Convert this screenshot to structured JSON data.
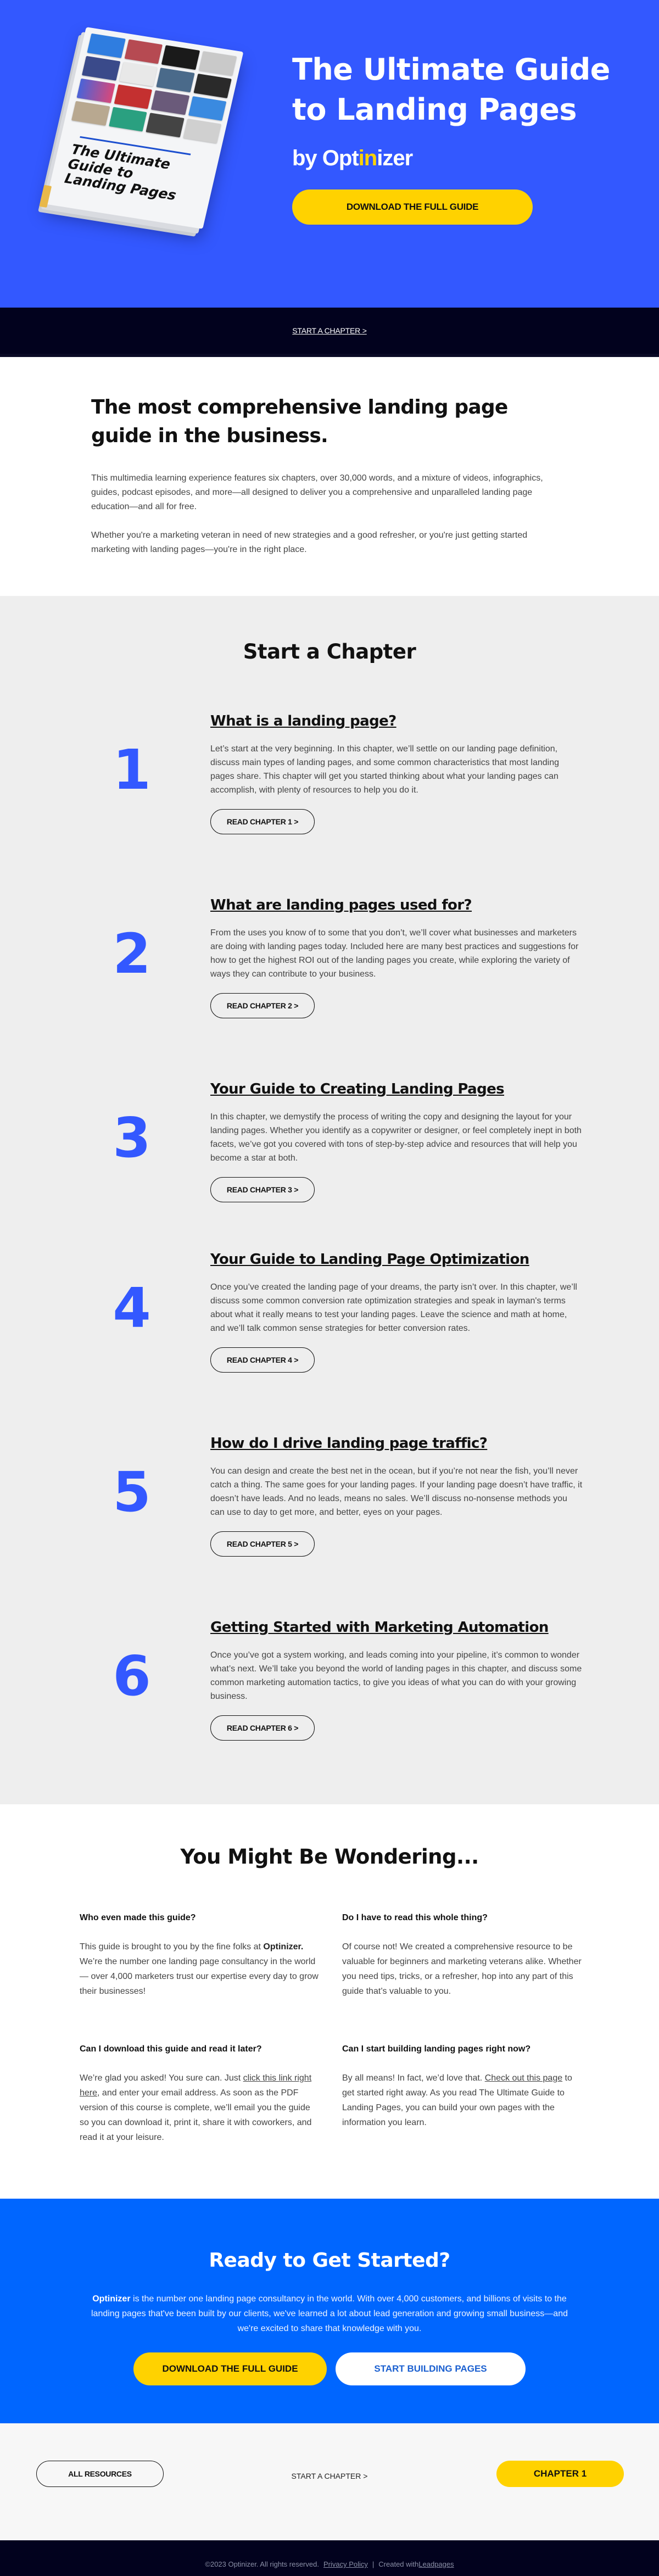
{
  "colors": {
    "hero_bg": "#3358ff",
    "accent_yellow": "#ffd200",
    "dark_nav": "#02021e",
    "chapters_bg": "#eeeeee",
    "cta_bg": "#0066ff",
    "chapter_number": "#3358ff"
  },
  "hero": {
    "book_cover_title": "The Ultimate Guide to Landing Pages",
    "title": "The Ultimate Guide to Landing Pages",
    "by_prefix": "by ",
    "brand_part1": "Opt",
    "brand_accent": "in",
    "brand_part2": "izer",
    "cta_label": "Download the full guide"
  },
  "top_nav": {
    "link_label": "START A CHAPTER >"
  },
  "intro": {
    "heading": "The most comprehensive landing page guide in the business.",
    "paragraphs": [
      "This multimedia learning experience features six chapters, over 30,000 words, and a mixture of videos, infographics, guides, podcast episodes, and more—all designed to deliver you a comprehensive and unparalleled landing page education—and all for free.",
      "Whether you're a marketing veteran in need of new strategies and a good refresher, or you're just getting started marketing with landing pages—you're in the right place."
    ]
  },
  "chapters": {
    "heading": "Start a Chapter",
    "items": [
      {
        "number": "1",
        "title": "What is a landing page?",
        "description": "Let’s start at the very beginning. In this chapter, we’ll settle on our landing page definition, discuss main types of landing pages, and some common characteristics that most landing pages share. This chapter will get you started thinking about what your landing pages can accomplish, with plenty of resources to help you do it.",
        "button": "Read chapter 1 >"
      },
      {
        "number": "2",
        "title": "What are landing pages used for?",
        "description": "From the uses you know of to some that you don’t, we’ll cover what businesses and marketers are doing with landing pages today. Included here are many best practices and suggestions for how to get the highest ROI out of the landing pages you create, while exploring the variety of ways they can contribute to your business.",
        "button": "Read chapter 2 >"
      },
      {
        "number": "3",
        "title": "Your Guide to Creating Landing Pages",
        "description": "In this chapter, we demystify the process of writing the copy and designing the layout for your landing pages. Whether you identify as a copywriter or designer, or feel completely inept in both facets, we’ve got you covered with tons of step-by-step advice and resources that will help you become a star at both.",
        "button": "Read chapter 3 >"
      },
      {
        "number": "4",
        "title": "Your Guide to Landing Page Optimization",
        "description": "Once you’ve created the landing page of your dreams, the party isn’t over. In this chapter, we’ll discuss some common conversion rate optimization strategies and speak in layman's terms about what it really means to test your landing pages. Leave the science and math at home, and we’ll talk common sense strategies for better conversion rates.",
        "button": "Read chapter 4 >"
      },
      {
        "number": "5",
        "title": "How do I drive landing page traffic?",
        "description": "You can design and create the best net in the ocean, but if you’re not near the fish, you’ll never catch a thing. The same goes for your landing pages. If your landing page doesn’t have traffic, it doesn’t have leads. And no leads, means no sales. We’ll discuss no-nonsense methods you can use to day to get more, and better, eyes on your pages.",
        "button": "Read chapter 5 >"
      },
      {
        "number": "6",
        "title": "Getting Started with Marketing Automation",
        "description": "Once you’ve got a system working, and leads coming into your pipeline, it’s common to wonder what’s next. We’ll take you beyond the world of landing pages in this chapter, and discuss some common marketing automation tactics, to give you ideas of what you can do with your growing business.",
        "button": "Read chapter 6 >"
      }
    ]
  },
  "faq": {
    "heading": "You Might Be Wondering...",
    "items": [
      {
        "question": "Who even made this guide?",
        "answer_pre": "This guide is brought to you by the fine folks at ",
        "answer_bold": "Optinizer.",
        "answer_post": " We’re the number one landing page consultancy in the world — over 4,000 marketers trust our expertise every day to grow their businesses!"
      },
      {
        "question": "Do I have to read this whole thing?",
        "answer": "Of course not! We created a comprehensive resource to be valuable for beginners and marketing veterans alike. Whether you need tips, tricks, or a refresher, hop into any part of this guide that’s valuable to you."
      },
      {
        "question": "Can I download this guide and read it later?",
        "answer_pre": "We’re glad you asked! You sure can. Just ",
        "answer_link": "click this link right here",
        "answer_post": ", and enter your email address. As soon as the PDF version of this course is complete, we’ll email you the guide so you can download it, print it, share it with coworkers, and read it at your leisure."
      },
      {
        "question": "Can I start building landing pages right now?",
        "answer_pre": "By all means! In fact, we’d love that. ",
        "answer_link": "Check out this page",
        "answer_post": " to get started right away. As you read The Ultimate Guide to Landing Pages, you can build your own pages with the information you learn."
      }
    ]
  },
  "cta": {
    "heading": "Ready to Get Started?",
    "body_bold": "Optinizer",
    "body": " is the number one landing page consultancy in the world. With over 4,000 customers, and billions of visits to the landing pages that've been built by our clients, we've learned a lot about lead generation and growing small business—and we're excited to share that knowledge with you.",
    "primary_button": "Download the full guide",
    "secondary_button": "Start building pages"
  },
  "footer_nav": {
    "all_resources": "All resources",
    "start_chapter": "START A CHAPTER >",
    "chapter_one": "Chapter 1"
  },
  "footer": {
    "copyright": "©2023 Optinizer. All rights reserved.",
    "privacy_link": "Privacy Policy",
    "separator": "|",
    "created_with": "Created with ",
    "leadpages_link": "Leadpages"
  }
}
